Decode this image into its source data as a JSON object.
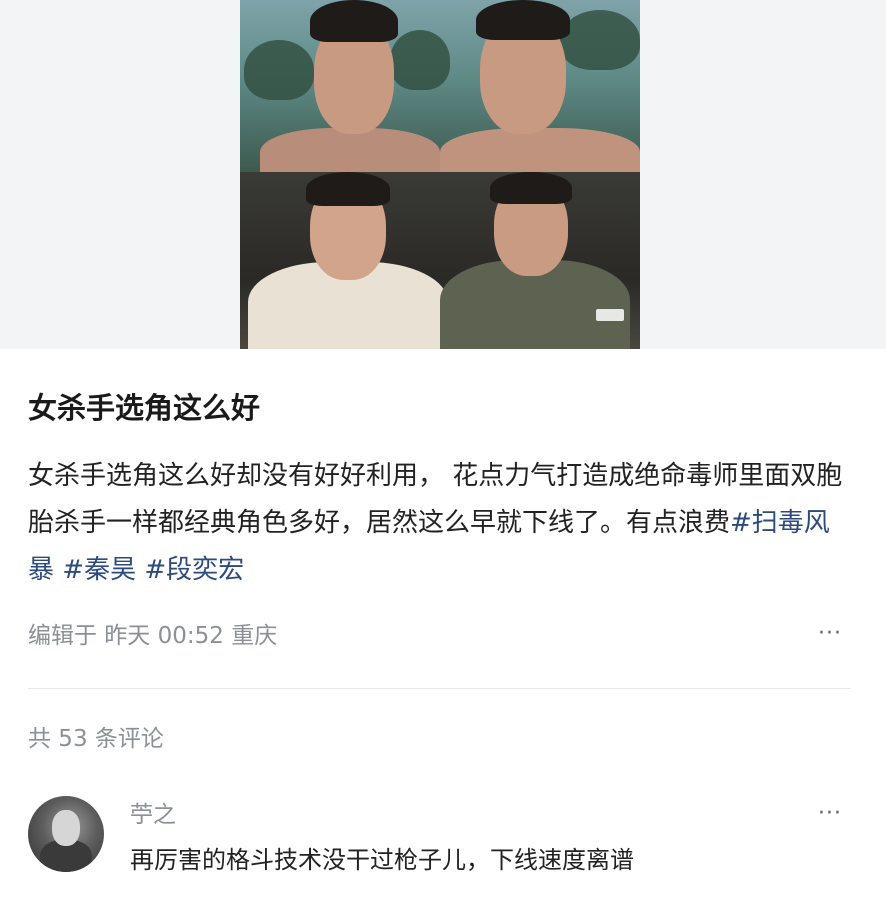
{
  "post": {
    "title": "女杀手选角这么好",
    "body_text": "女杀手选角这么好却没有好好利用， 花点力气打造成绝命毒师里面双胞胎杀手一样都经典角色多好，居然这么早就下线了。有点浪费",
    "hashtags": [
      "#扫毒风暴",
      "#秦昊",
      "#段奕宏"
    ],
    "meta": "编辑于 昨天 00:52 重庆",
    "more_icon": "ellipsis-icon",
    "more_label": "···"
  },
  "comments_header": {
    "count_text": "共 53 条评论"
  },
  "comments": [
    {
      "author": "苧之",
      "text": "再厉害的格斗技术没干过枪子儿，下线速度离谱",
      "more_label": "···"
    }
  ],
  "colors": {
    "hashtag": "#2b4a7e",
    "meta": "#8a8f99",
    "text": "#222222",
    "divider": "#e6e7ea"
  }
}
